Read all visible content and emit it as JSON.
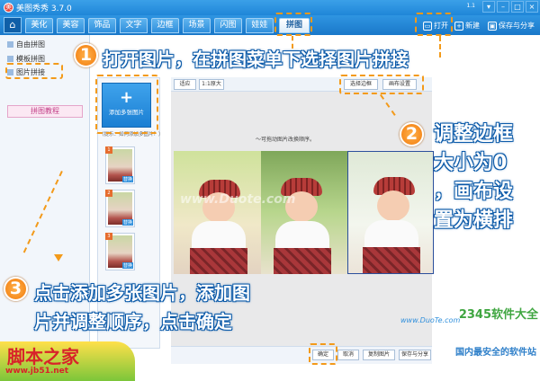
{
  "window": {
    "title": "美图秀秀 3.7.0",
    "app_icon": "meitu-logo",
    "version_hint": "1.1"
  },
  "menu": {
    "home_icon": "home-icon",
    "tabs": [
      {
        "label": "美化"
      },
      {
        "label": "美容"
      },
      {
        "label": "饰品"
      },
      {
        "label": "文字"
      },
      {
        "label": "边框"
      },
      {
        "label": "场景"
      },
      {
        "label": "闪图"
      },
      {
        "label": "娃娃"
      },
      {
        "label": "拼图"
      }
    ],
    "active_tab": "拼图",
    "open_label": "打开",
    "new_label": "新建",
    "save_label": "保存与分享"
  },
  "sidebar": {
    "items": [
      {
        "label": "自由拼图"
      },
      {
        "label": "模板拼图"
      },
      {
        "label": "图片拼接"
      }
    ],
    "tutorial_label": "拼图教程"
  },
  "panel": {
    "add_button_label": "添加多张图片",
    "add_hint": "（提示：如何添加多图片？）",
    "thumbnails": [
      {
        "num": "1",
        "action": "替换"
      },
      {
        "num": "2",
        "action": "替换"
      },
      {
        "num": "3",
        "action": "替换"
      }
    ]
  },
  "editor": {
    "top_left_btn": "适应",
    "zoom_btn": "1:1原大",
    "border_btn": "选择边框",
    "canvas_btn": "画布设置",
    "hint": "～可拖动图片改换顺序。",
    "watermark": "www.Duote.com"
  },
  "bottom": {
    "ok_label": "确定",
    "cancel_label": "取消",
    "copy_label": "复制图片",
    "save_label": "保存与分享"
  },
  "annotations": {
    "step1_num": "1",
    "step1": "打开图片，在拼图菜单下选择图片拼接",
    "step2_num": "2",
    "step2_line1": "调整边框",
    "step2_line2": "大小为0",
    "step2_line3": "，画布设",
    "step2_line4": "置为横排",
    "step3_num": "3",
    "step3_line1": "点击添加多张图片，添加图",
    "step3_line2": "片并调整顺序，点击确定"
  },
  "logos": {
    "jb51_title": "脚本之家",
    "jb51_url": "www.jb51.net",
    "duote_domain": "www.DuoTe.com",
    "soft_brand": "2345软件大全",
    "soft_slogan": "国内最安全的软件站"
  },
  "colors": {
    "accent": "#1f86d8",
    "annotation_orange": "#f39a1a",
    "annotation_text_outline": "#0a59a8"
  }
}
